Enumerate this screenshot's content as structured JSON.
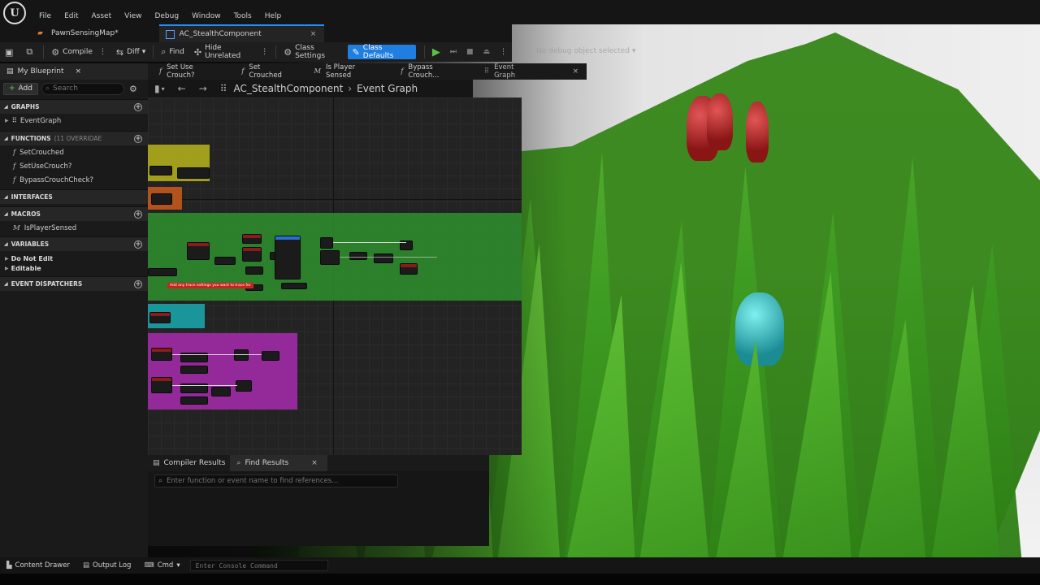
{
  "menu": [
    "File",
    "Edit",
    "Asset",
    "View",
    "Debug",
    "Window",
    "Tools",
    "Help"
  ],
  "doc_tabs": [
    {
      "label": "PawnSensingMap*"
    },
    {
      "label": "AC_StealthComponent"
    }
  ],
  "toolbar": {
    "compile": "Compile",
    "diff": "Diff",
    "find": "Find",
    "hide_unrelated": "Hide Unrelated",
    "class_settings": "Class Settings",
    "class_defaults": "Class Defaults",
    "debug_object": "No debug object selected"
  },
  "left_panel": {
    "tab_label": "My Blueprint",
    "add_label": "Add",
    "search_placeholder": "Search",
    "sections": {
      "graphs": "GRAPHS",
      "functions": "FUNCTIONS",
      "functions_sub": "(11 OVERRIDAE",
      "interfaces": "INTERFACES",
      "macros": "MACROS",
      "variables": "VARIABLES",
      "event_dispatchers": "EVENT DISPATCHERS"
    },
    "graph_items": [
      "EventGraph"
    ],
    "function_items": [
      "SetCrouched",
      "SetUseCrouch?",
      "BypassCrouchCheck?"
    ],
    "macro_items": [
      "IsPlayerSensed"
    ],
    "variable_groups": [
      "Do Not Edit",
      "Editable"
    ]
  },
  "graph_tabs": [
    {
      "label": "Set Use Crouch?",
      "icon": "f"
    },
    {
      "label": "Set Crouched",
      "icon": "f"
    },
    {
      "label": "Is Player Sensed",
      "icon": "M"
    },
    {
      "label": "Bypass Crouch...",
      "icon": "f"
    },
    {
      "label": "Event Graph",
      "icon": "graph"
    }
  ],
  "breadcrumb": {
    "root": "AC_StealthComponent",
    "leaf": "Event Graph"
  },
  "graph_comment": "Add any trace settings you want to trace for",
  "bottom_tabs": {
    "compiler": "Compiler Results",
    "find": "Find Results"
  },
  "find_placeholder": "Enter function or event name to find references...",
  "statusbar": {
    "content_drawer": "Content Drawer",
    "output_log": "Output Log",
    "cmd": "Cmd",
    "console_placeholder": "Enter Console Command"
  },
  "colors": {
    "accent": "#1f7ee0",
    "grass": "#4fae2a",
    "comment_yellow": "#b7b41a",
    "comment_green": "#2e8b2e",
    "comment_cyan": "#1aa3a8",
    "comment_magenta": "#a12aa6",
    "comment_orange": "#c2581c"
  }
}
